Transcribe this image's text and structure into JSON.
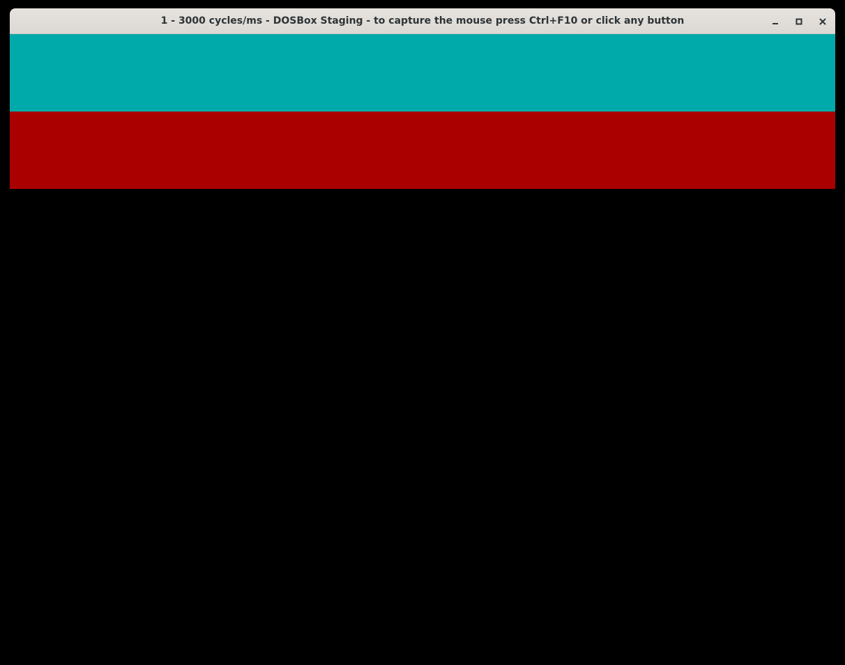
{
  "window": {
    "title": "1 - 3000 cycles/ms - DOSBox Staging - to capture the mouse press Ctrl+F10 or click any button",
    "controls": {
      "minimize_icon": "minimize-icon",
      "maximize_icon": "maximize-icon",
      "close_icon": "close-icon"
    }
  },
  "screen": {
    "band_top_color": "#00aaaa",
    "band_bottom_color": "#aa0000",
    "desktop_background": "#000000"
  }
}
